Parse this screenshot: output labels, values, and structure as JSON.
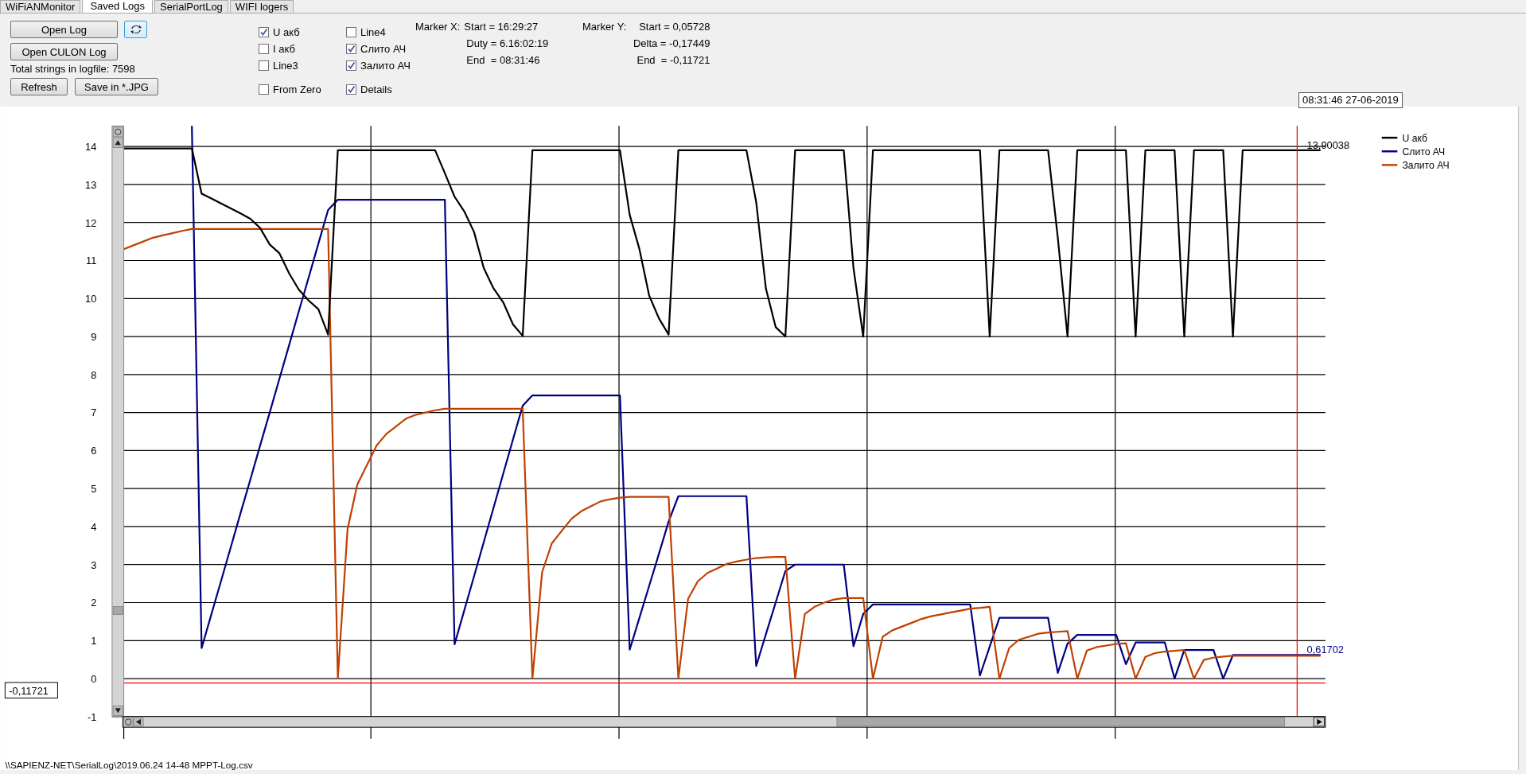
{
  "tabs": [
    {
      "label": "WiFiANMonitor",
      "selected": false
    },
    {
      "label": "Saved Logs",
      "selected": true
    },
    {
      "label": "SerialPortLog",
      "selected": false
    },
    {
      "label": "WIFI logers",
      "selected": false
    }
  ],
  "controls": {
    "open_log_button": "Open Log",
    "open_culon_button": "Open CULON Log",
    "total_strings": "Total strings in logfile: 7598",
    "refresh_button": "Refresh",
    "save_button": "Save in *.JPG"
  },
  "checkboxes": [
    {
      "label": "U акб",
      "checked": true
    },
    {
      "label": "I акб",
      "checked": false
    },
    {
      "label": "Line3",
      "checked": false
    },
    {
      "label": "From Zero",
      "checked": false
    },
    {
      "label": "Line4",
      "checked": false
    },
    {
      "label": "Слито АЧ",
      "checked": true
    },
    {
      "label": "Залито АЧ",
      "checked": true
    },
    {
      "label": "Details",
      "checked": true
    }
  ],
  "markers": {
    "x": {
      "label": "Marker X:",
      "lines": [
        "Start = 16:29:27",
        "Duty = 6.16:02:19",
        "End  = 08:31:46"
      ]
    },
    "y": {
      "label": "Marker Y:",
      "lines": [
        "Start = 0,05728",
        "Delta = -0,17449",
        "End  = -0,11721"
      ]
    }
  },
  "date_box": "08:31:46 27-06-2019",
  "chart": {
    "cursor_value": "-0,11721",
    "end_labels": [
      {
        "text": "13,90038",
        "color": "#000000"
      },
      {
        "text": "0,61702",
        "color": "#000080"
      }
    ],
    "chart_data": {
      "type": "line",
      "grid": true,
      "legend": "right",
      "ylim": [
        -1,
        14.54
      ],
      "yticks": [
        -1,
        0,
        1,
        2,
        3,
        4,
        5,
        6,
        7,
        8,
        9,
        10,
        11,
        12,
        13,
        14
      ],
      "categories": [
        null,
        null,
        null,
        null,
        null,
        null,
        null,
        null,
        null,
        null,
        null,
        null,
        null,
        null,
        null,
        null,
        null,
        null,
        null,
        null,
        null,
        null,
        null,
        null,
        null,
        null,
        null,
        null,
        null,
        null,
        null,
        null,
        null,
        null,
        null,
        null,
        null,
        null,
        null,
        null,
        null,
        null,
        null,
        null,
        null,
        null,
        null,
        null,
        null,
        null,
        null,
        null,
        null,
        null,
        null,
        null,
        null,
        null,
        null,
        null,
        null,
        null,
        null,
        null,
        null,
        null,
        null,
        null,
        null,
        null,
        null,
        null,
        null,
        null,
        null,
        null,
        null,
        null,
        null,
        null,
        null,
        null,
        null,
        null,
        null,
        null,
        null,
        null,
        null,
        null,
        null,
        null,
        null,
        null,
        null,
        null,
        null,
        null,
        null,
        null,
        null,
        null,
        null,
        null,
        null,
        null,
        null,
        null,
        null,
        null,
        null,
        null,
        null,
        null,
        null,
        null,
        null,
        null,
        null,
        null,
        null,
        null,
        null,
        null
      ],
      "series": [
        {
          "name": "U акб",
          "color": "#000000",
          "values": [
            13.95,
            13.95,
            13.95,
            13.95,
            13.95,
            13.95,
            13.95,
            13.95,
            12.76,
            12.63,
            12.5,
            12.37,
            12.24,
            12.1,
            11.86,
            11.42,
            11.19,
            10.66,
            10.23,
            9.95,
            9.72,
            9.05,
            13.9,
            13.9,
            13.9,
            13.9,
            13.9,
            13.9,
            13.9,
            13.9,
            13.9,
            13.9,
            13.9,
            13.3,
            12.68,
            12.29,
            11.75,
            10.8,
            10.27,
            9.9,
            9.32,
            9.02,
            13.9,
            13.9,
            13.9,
            13.9,
            13.9,
            13.9,
            13.9,
            13.9,
            13.9,
            13.9,
            12.2,
            11.3,
            10.08,
            9.48,
            9.05,
            13.9,
            13.9,
            13.9,
            13.9,
            13.9,
            13.9,
            13.9,
            13.9,
            12.54,
            10.26,
            9.25,
            9.0,
            13.9,
            13.9,
            13.9,
            13.9,
            13.9,
            13.9,
            10.8,
            9.0,
            13.9,
            13.9,
            13.9,
            13.9,
            13.9,
            13.9,
            13.9,
            13.9,
            13.9,
            13.9,
            13.9,
            13.9,
            9.0,
            13.9,
            13.9,
            13.9,
            13.9,
            13.9,
            13.9,
            11.6,
            9.0,
            13.9,
            13.9,
            13.9,
            13.9,
            13.9,
            13.9,
            9.0,
            13.9,
            13.9,
            13.9,
            13.9,
            9.0,
            13.9,
            13.9,
            13.9,
            13.9,
            9.0,
            13.9,
            13.9,
            13.9,
            13.9,
            13.9,
            13.9,
            13.9,
            13.9,
            13.9
          ]
        },
        {
          "name": "Слито АЧ",
          "color": "#000080",
          "values": [
            null,
            null,
            null,
            null,
            null,
            null,
            null,
            14.54,
            0.8,
            1.69,
            2.57,
            3.46,
            4.35,
            5.23,
            6.12,
            7.0,
            7.89,
            8.78,
            9.67,
            10.55,
            11.44,
            12.33,
            12.6,
            12.6,
            12.6,
            12.6,
            12.6,
            12.6,
            12.6,
            12.6,
            12.6,
            12.6,
            12.6,
            12.6,
            0.9,
            1.8,
            2.69,
            3.59,
            4.49,
            5.39,
            6.29,
            7.18,
            7.45,
            7.45,
            7.45,
            7.45,
            7.45,
            7.45,
            7.45,
            7.45,
            7.45,
            7.45,
            0.76,
            1.6,
            2.44,
            3.28,
            4.13,
            4.8,
            4.8,
            4.8,
            4.8,
            4.8,
            4.8,
            4.8,
            4.8,
            0.33,
            1.17,
            2.0,
            2.83,
            3.0,
            3.0,
            3.0,
            3.0,
            3.0,
            3.0,
            0.85,
            1.7,
            1.95,
            1.95,
            1.95,
            1.95,
            1.95,
            1.95,
            1.95,
            1.95,
            1.95,
            1.95,
            1.95,
            0.08,
            0.84,
            1.6,
            1.6,
            1.6,
            1.6,
            1.6,
            1.6,
            0.15,
            0.92,
            1.15,
            1.15,
            1.15,
            1.15,
            1.15,
            0.38,
            0.95,
            0.95,
            0.95,
            0.95,
            0,
            0.75,
            0.75,
            0.75,
            0.75,
            0,
            0.62,
            0.62,
            0.62,
            0.62,
            0.62,
            0.62,
            0.62,
            0.62,
            0.62,
            0.62
          ]
        },
        {
          "name": "Залито АЧ",
          "color": "#c04000",
          "values": [
            11.3,
            11.4,
            11.5,
            11.6,
            11.66,
            11.72,
            11.78,
            11.83,
            11.83,
            11.83,
            11.83,
            11.83,
            11.83,
            11.83,
            11.83,
            11.83,
            11.83,
            11.83,
            11.83,
            11.83,
            11.83,
            11.83,
            0,
            3.93,
            5.1,
            5.62,
            6.14,
            6.44,
            6.64,
            6.84,
            6.94,
            7.0,
            7.06,
            7.1,
            7.1,
            7.1,
            7.1,
            7.1,
            7.1,
            7.1,
            7.1,
            7.1,
            0,
            2.8,
            3.56,
            3.88,
            4.2,
            4.4,
            4.53,
            4.66,
            4.72,
            4.76,
            4.78,
            4.78,
            4.78,
            4.78,
            4.78,
            0,
            2.1,
            2.56,
            2.78,
            2.9,
            3.02,
            3.08,
            3.13,
            3.17,
            3.19,
            3.2,
            3.2,
            0,
            1.7,
            1.89,
            2.0,
            2.08,
            2.12,
            2.12,
            2.12,
            0,
            1.1,
            1.27,
            1.37,
            1.47,
            1.57,
            1.64,
            1.69,
            1.74,
            1.79,
            1.84,
            1.86,
            1.89,
            0,
            0.8,
            1.02,
            1.1,
            1.18,
            1.21,
            1.23,
            1.25,
            0,
            0.74,
            0.83,
            0.87,
            0.91,
            0.93,
            0,
            0.57,
            0.67,
            0.71,
            0.73,
            0.75,
            0,
            0.49,
            0.55,
            0.58,
            0.6,
            0.6,
            0.6,
            0.6,
            0.6,
            0.6,
            0.6,
            0.6,
            0.6,
            0.6
          ]
        }
      ],
      "ref_lines": [
        {
          "axis": "y",
          "value": -0.11721,
          "color": "#ff0000"
        }
      ]
    }
  },
  "status_bar": {
    "path": "\\\\SAPIENZ-NET\\SerialLog\\2019.06.24 14-48 MPPT-Log.csv"
  }
}
